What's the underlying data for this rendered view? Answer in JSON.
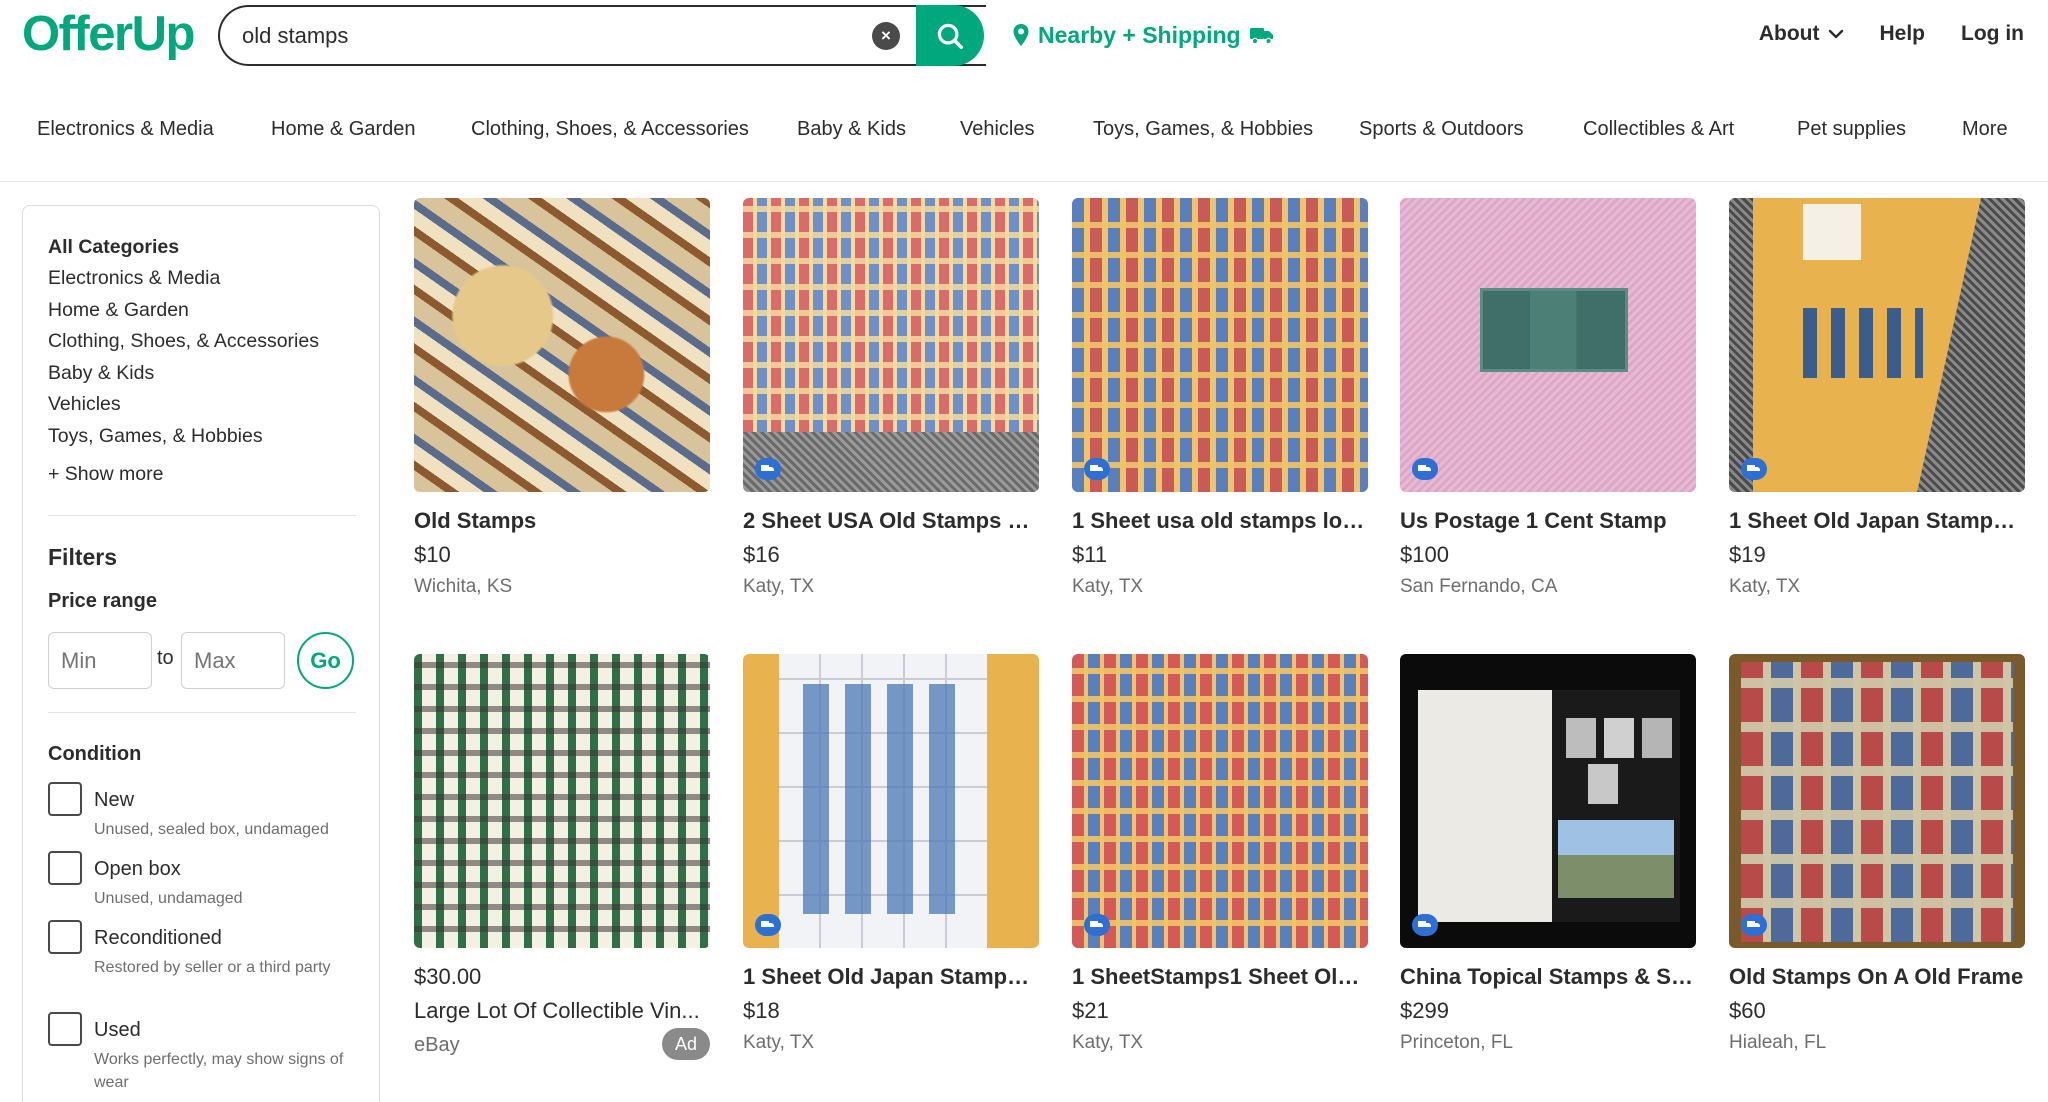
{
  "header": {
    "logo": "OfferUp",
    "search_value": "old stamps",
    "location": "Nearby + Shipping",
    "about": "About",
    "help": "Help",
    "login": "Log in"
  },
  "categories": [
    "Electronics & Media",
    "Home & Garden",
    "Clothing, Shoes, & Accessories",
    "Baby & Kids",
    "Vehicles",
    "Toys, Games, & Hobbies",
    "Sports & Outdoors",
    "Collectibles & Art",
    "Pet supplies",
    "More"
  ],
  "sidebar": {
    "all_categories": "All Categories",
    "items": [
      "Electronics & Media",
      "Home & Garden",
      "Clothing, Shoes, & Accessories",
      "Baby & Kids",
      "Vehicles",
      "Toys, Games, & Hobbies"
    ],
    "show_more": "+ Show more",
    "filters": "Filters",
    "price_range": "Price range",
    "min_placeholder": "Min",
    "max_placeholder": "Max",
    "to": "to",
    "go": "Go",
    "condition": "Condition",
    "conditions": [
      {
        "label": "New",
        "desc": "Unused, sealed box, undamaged"
      },
      {
        "label": "Open box",
        "desc": "Unused, undamaged"
      },
      {
        "label": "Reconditioned",
        "desc": "Restored by seller or a third party"
      },
      {
        "label": "Used",
        "desc": "Works perfectly, may show signs of wear"
      }
    ]
  },
  "listings": [
    {
      "title": "Old Stamps",
      "price": "$10",
      "location": "Wichita, KS"
    },
    {
      "title": "2 Sheet USA Old Stamps L...",
      "price": "$16",
      "location": "Katy, TX"
    },
    {
      "title": "1 Sheet usa old stamps lot ...",
      "price": "$11",
      "location": "Katy, TX"
    },
    {
      "title": "Us Postage 1 Cent Stamp",
      "price": "$100",
      "location": "San Fernando, CA"
    },
    {
      "title": "1 Sheet Old Japan Stamps ...",
      "price": "$19",
      "location": "Katy, TX"
    },
    {
      "price": "$30.00",
      "title": "Large Lot Of Collectible Vin...",
      "seller": "eBay",
      "badge": "Ad"
    },
    {
      "title": "1 Sheet Old Japan Stamps ...",
      "price": "$18",
      "location": "Katy, TX"
    },
    {
      "title": "1 SheetStamps1 Sheet Old ...",
      "price": "$21",
      "location": "Katy, TX"
    },
    {
      "title": "China Topical Stamps & Sta...",
      "price": "$299",
      "location": "Princeton, FL"
    },
    {
      "title": "Old Stamps On A Old Frame",
      "price": "$60",
      "location": "Hialeah, FL"
    }
  ],
  "colors": {
    "brand": "#00a87e",
    "text": "#2c2c2c",
    "muted": "#6e6e6e",
    "shipping_badge": "#2d6fd2"
  },
  "icons": [
    "search-icon",
    "clear-icon",
    "location-pin-icon",
    "truck-icon",
    "chevron-down-icon",
    "shipping-badge-icon"
  ]
}
